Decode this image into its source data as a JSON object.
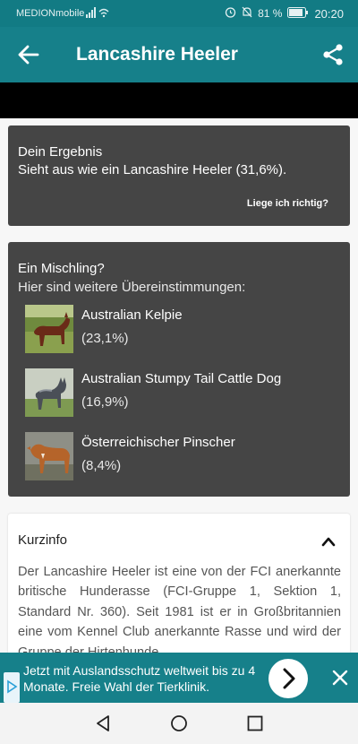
{
  "status_bar": {
    "carrier": "MEDIONmobile",
    "battery": "81 %",
    "time": "20:20"
  },
  "app_bar": {
    "title": "Lancashire Heeler"
  },
  "result": {
    "heading": "Dein Ergebnis",
    "text": "Sieht aus wie ein Lancashire Heeler (31,6%).",
    "feedback_link": "Liege ich richtig?"
  },
  "mix": {
    "heading": "Ein Mischling?",
    "subheading": "Hier sind weitere Übereinstimmungen:",
    "matches": [
      {
        "name": "Australian Kelpie",
        "percent": "(23,1%)"
      },
      {
        "name": "Australian Stumpy Tail Cattle Dog",
        "percent": "(16,9%)"
      },
      {
        "name": "Österreichischer Pinscher",
        "percent": "(8,4%)"
      }
    ]
  },
  "info": {
    "heading": "Kurzinfo",
    "body": "Der Lancashire Heeler ist eine von der FCI anerkannte britische Hunderasse (FCI-Gruppe 1, Sektion 1, Standard Nr. 360). Seit 1981 ist er in Großbritannien eine vom Kennel Club anerkannte Rasse und wird der Gruppe der Hirtenhunde"
  },
  "ad": {
    "text": "Jetzt mit Auslandsschutz weltweit bis zu 4 Monate. Freie Wahl der Tierklinik."
  },
  "colors": {
    "primary": "#16808a",
    "status_bar": "#127b84",
    "card_dark": "#454545"
  },
  "icons": {
    "back": "arrow-left",
    "share": "share",
    "collapse": "chevron-up",
    "ad_go": "chevron-right",
    "ad_close": "close",
    "nav": [
      "back-triangle",
      "home-circle",
      "recents-square"
    ]
  }
}
